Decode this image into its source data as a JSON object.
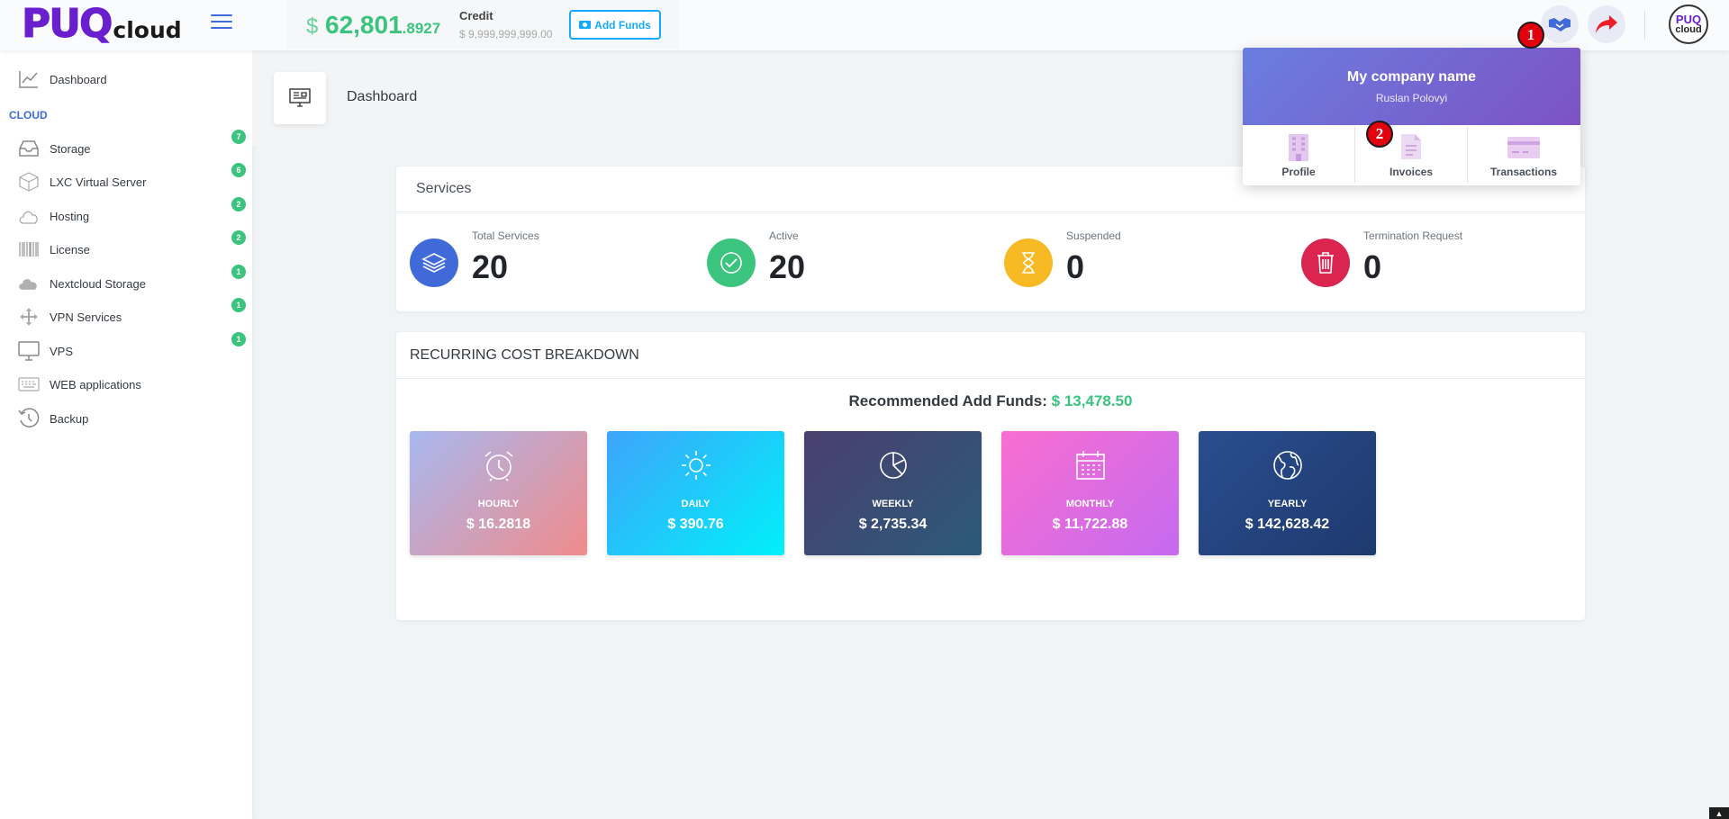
{
  "header": {
    "logo_main": "PUQ",
    "logo_sub": "cloud",
    "balance_currency": "$",
    "balance_main": "62,801",
    "balance_decimals": ".8927",
    "credit_label": "Credit",
    "credit_value": "$ 9,999,999,999.00",
    "add_funds_label": "Add Funds",
    "avatar_line1": "PUQ",
    "avatar_line2": "cloud",
    "step1": "1",
    "step2": "2"
  },
  "sidebar": {
    "dashboard_label": "Dashboard",
    "heading": "CLOUD",
    "items": [
      {
        "label": "Storage",
        "count": "7",
        "icon": "storage-icon"
      },
      {
        "label": "LXC Virtual Server",
        "count": "6",
        "icon": "cube-icon"
      },
      {
        "label": "Hosting",
        "count": "2",
        "icon": "cloud-icon"
      },
      {
        "label": "License",
        "count": "2",
        "icon": "barcode-icon"
      },
      {
        "label": "Nextcloud Storage",
        "count": "1",
        "icon": "cloud-filled-icon"
      },
      {
        "label": "VPN Services",
        "count": "1",
        "icon": "arrows-icon"
      },
      {
        "label": "VPS",
        "count": "1",
        "icon": "monitor-icon"
      },
      {
        "label": "WEB applications",
        "icon": "keyboard-icon"
      },
      {
        "label": "Backup",
        "icon": "history-icon"
      }
    ]
  },
  "page": {
    "title": "Dashboard"
  },
  "services": {
    "title": "Services",
    "stats": [
      {
        "label": "Total Services",
        "value": "20",
        "color": "#3f6ad8"
      },
      {
        "label": "Active",
        "value": "20",
        "color": "#3ac47d"
      },
      {
        "label": "Suspended",
        "value": "0",
        "color": "#f7b924"
      },
      {
        "label": "Termination Request",
        "value": "0",
        "color": "#d92550"
      }
    ]
  },
  "costs": {
    "title": "RECURRING COST BREAKDOWN",
    "recommended_label": "Recommended Add Funds:",
    "recommended_value": "$ 13,478.50",
    "tiles": [
      {
        "label": "HOURLY",
        "value": "$ 16.2818",
        "icon": "alarm-clock-icon"
      },
      {
        "label": "DAILY",
        "value": "$ 390.76",
        "icon": "sun-icon"
      },
      {
        "label": "WEEKLY",
        "value": "$ 2,735.34",
        "icon": "pie-chart-icon"
      },
      {
        "label": "MONTHLY",
        "value": "$ 11,722.88",
        "icon": "calendar-icon"
      },
      {
        "label": "YEARLY",
        "value": "$ 142,628.42",
        "icon": "globe-icon"
      }
    ]
  },
  "dropdown": {
    "company": "My company name",
    "user": "Ruslan Polovyi",
    "items": [
      {
        "label": "Profile",
        "icon": "building-icon"
      },
      {
        "label": "Invoices",
        "icon": "document-icon"
      },
      {
        "label": "Transactions",
        "icon": "card-icon"
      }
    ]
  }
}
